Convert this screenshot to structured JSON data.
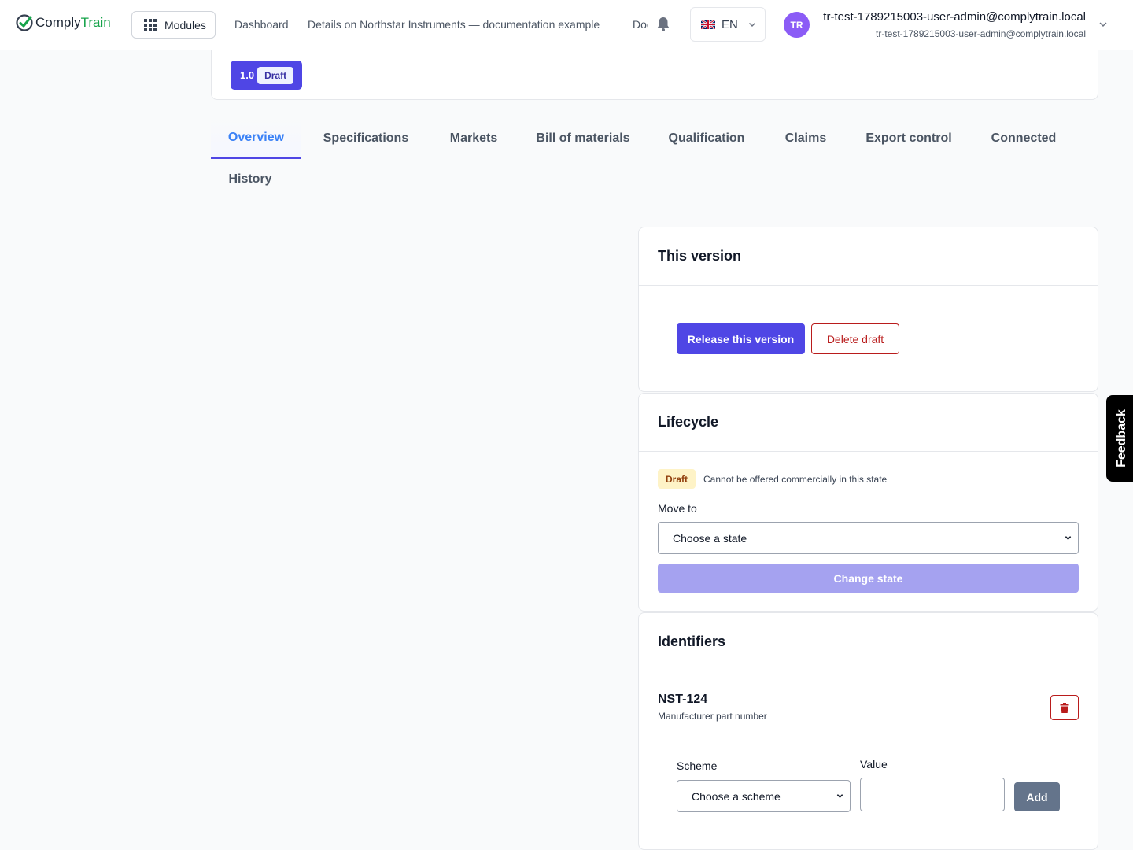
{
  "header": {
    "logo_part1": "Comply",
    "logo_part2": "Train",
    "modules_label": "Modules",
    "nav": [
      "Dashboard",
      "Details on Northstar Instruments — documentation example",
      "Documents"
    ],
    "language": "EN",
    "avatar_initials": "TR",
    "user_name": "tr-test-1789215003-user-admin@complytrain.local",
    "user_email": "tr-test-1789215003-user-admin@complytrain.local"
  },
  "version": {
    "number": "1.0",
    "status": "Draft"
  },
  "tabs": [
    "Overview",
    "Specifications",
    "Markets",
    "Bill of materials",
    "Qualification",
    "Claims",
    "Export control",
    "Connected",
    "History"
  ],
  "this_version": {
    "title": "This version",
    "release_label": "Release this version",
    "delete_label": "Delete draft"
  },
  "lifecycle": {
    "title": "Lifecycle",
    "state": "Draft",
    "state_note": "Cannot be offered commercially in this state",
    "move_to_label": "Move to",
    "select_value": "Choose a state",
    "change_label": "Change state"
  },
  "identifiers": {
    "title": "Identifiers",
    "item_value": "NST-124",
    "item_type": "Manufacturer part number",
    "scheme_label": "Scheme",
    "scheme_value": "Choose a scheme",
    "value_label": "Value",
    "value_input": "",
    "add_label": "Add"
  },
  "feedback_label": "Feedback",
  "colors": {
    "primary": "#4f46e5",
    "danger": "#b91c1c",
    "active_tab_text": "#3b82f6",
    "brand_green": "#16a34a"
  }
}
